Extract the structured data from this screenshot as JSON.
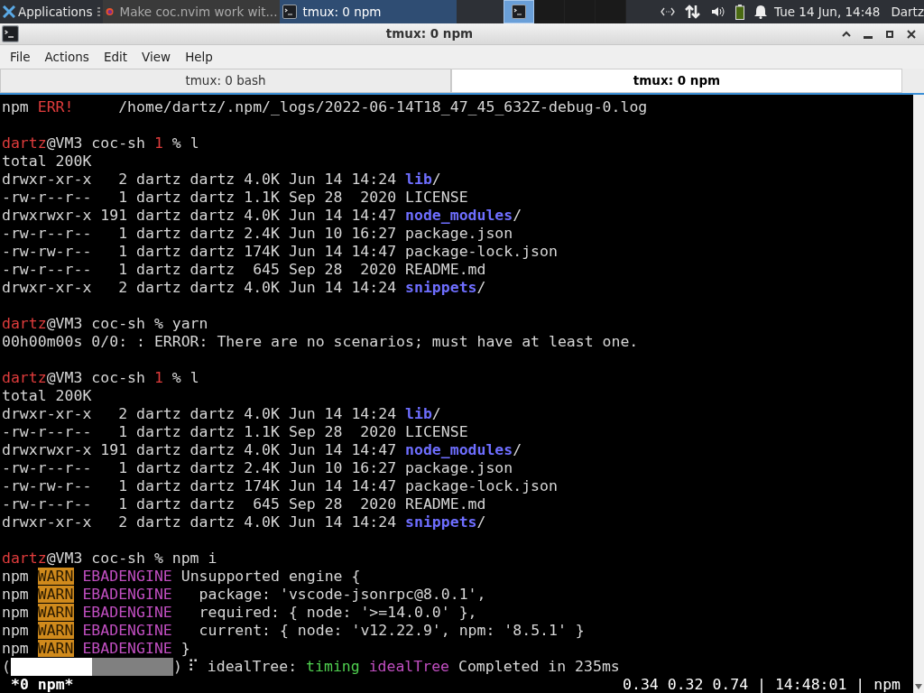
{
  "panel": {
    "apps_label": "Applications",
    "tasks": [
      {
        "title": "Make coc.nvim work wit...",
        "kind": "browser",
        "selected": false
      },
      {
        "title": "tmux: 0 npm",
        "kind": "terminal",
        "selected": true
      }
    ],
    "workspaces": [
      {
        "selected": true
      },
      {
        "selected": false
      },
      {
        "selected": false
      },
      {
        "selected": false
      }
    ],
    "clock": "Tue 14 Jun, 14:48",
    "user": "Dartz"
  },
  "window": {
    "title": "tmux: 0 npm"
  },
  "menu": [
    "File",
    "Actions",
    "Edit",
    "View",
    "Help"
  ],
  "tabs": [
    {
      "label": "tmux: 0 bash",
      "selected": false
    },
    {
      "label": "tmux: 0 npm",
      "selected": true
    }
  ],
  "terminal": {
    "lines": [
      {
        "segments": [
          {
            "text": "npm ",
            "kind": "plain"
          },
          {
            "text": "ERR!",
            "kind": "error"
          },
          {
            "text": "     /home/dartz/.npm/_logs/2022-06-14T18_47_45_632Z-debug-0.log",
            "kind": "plain"
          }
        ]
      },
      {
        "kind": "blank"
      },
      {
        "segments": [
          {
            "text": "dartz",
            "kind": "user"
          },
          {
            "text": "@VM3 coc-sh ",
            "kind": "plain"
          },
          {
            "text": "1",
            "kind": "error"
          },
          {
            "text": " % l",
            "kind": "plain"
          }
        ]
      },
      {
        "segments": [
          {
            "text": "total 200K",
            "kind": "plain"
          }
        ]
      },
      {
        "segments": [
          {
            "text": "drwxr-xr-x   2 dartz dartz 4.0K Jun 14 14:24 ",
            "kind": "plain"
          },
          {
            "text": "lib",
            "kind": "dir"
          },
          {
            "text": "/",
            "kind": "plain"
          }
        ]
      },
      {
        "segments": [
          {
            "text": "-rw-r--r--   1 dartz dartz 1.1K Sep 28  2020 LICENSE",
            "kind": "plain"
          }
        ]
      },
      {
        "segments": [
          {
            "text": "drwxrwxr-x 191 dartz dartz 4.0K Jun 14 14:47 ",
            "kind": "plain"
          },
          {
            "text": "node_modules",
            "kind": "dir"
          },
          {
            "text": "/",
            "kind": "plain"
          }
        ]
      },
      {
        "segments": [
          {
            "text": "-rw-r--r--   1 dartz dartz 2.4K Jun 10 16:27 package.json",
            "kind": "plain"
          }
        ]
      },
      {
        "segments": [
          {
            "text": "-rw-rw-r--   1 dartz dartz 174K Jun 14 14:47 package-lock.json",
            "kind": "plain"
          }
        ]
      },
      {
        "segments": [
          {
            "text": "-rw-r--r--   1 dartz dartz  645 Sep 28  2020 README.md",
            "kind": "plain"
          }
        ]
      },
      {
        "segments": [
          {
            "text": "drwxr-xr-x   2 dartz dartz 4.0K Jun 14 14:24 ",
            "kind": "plain"
          },
          {
            "text": "snippets",
            "kind": "dir"
          },
          {
            "text": "/",
            "kind": "plain"
          }
        ]
      },
      {
        "kind": "blank"
      },
      {
        "segments": [
          {
            "text": "dartz",
            "kind": "user"
          },
          {
            "text": "@VM3 coc-sh % yarn",
            "kind": "plain"
          }
        ]
      },
      {
        "segments": [
          {
            "text": "00h00m00s 0/0: : ERROR: There are no scenarios; must have at least one.",
            "kind": "plain"
          }
        ]
      },
      {
        "kind": "blank"
      },
      {
        "segments": [
          {
            "text": "dartz",
            "kind": "user"
          },
          {
            "text": "@VM3 coc-sh ",
            "kind": "plain"
          },
          {
            "text": "1",
            "kind": "error"
          },
          {
            "text": " % l",
            "kind": "plain"
          }
        ]
      },
      {
        "segments": [
          {
            "text": "total 200K",
            "kind": "plain"
          }
        ]
      },
      {
        "segments": [
          {
            "text": "drwxr-xr-x   2 dartz dartz 4.0K Jun 14 14:24 ",
            "kind": "plain"
          },
          {
            "text": "lib",
            "kind": "dir"
          },
          {
            "text": "/",
            "kind": "plain"
          }
        ]
      },
      {
        "segments": [
          {
            "text": "-rw-r--r--   1 dartz dartz 1.1K Sep 28  2020 LICENSE",
            "kind": "plain"
          }
        ]
      },
      {
        "segments": [
          {
            "text": "drwxrwxr-x 191 dartz dartz 4.0K Jun 14 14:47 ",
            "kind": "plain"
          },
          {
            "text": "node_modules",
            "kind": "dir"
          },
          {
            "text": "/",
            "kind": "plain"
          }
        ]
      },
      {
        "segments": [
          {
            "text": "-rw-r--r--   1 dartz dartz 2.4K Jun 10 16:27 package.json",
            "kind": "plain"
          }
        ]
      },
      {
        "segments": [
          {
            "text": "-rw-rw-r--   1 dartz dartz 174K Jun 14 14:47 package-lock.json",
            "kind": "plain"
          }
        ]
      },
      {
        "segments": [
          {
            "text": "-rw-r--r--   1 dartz dartz  645 Sep 28  2020 README.md",
            "kind": "plain"
          }
        ]
      },
      {
        "segments": [
          {
            "text": "drwxr-xr-x   2 dartz dartz 4.0K Jun 14 14:24 ",
            "kind": "plain"
          },
          {
            "text": "snippets",
            "kind": "dir"
          },
          {
            "text": "/",
            "kind": "plain"
          }
        ]
      },
      {
        "kind": "blank"
      },
      {
        "segments": [
          {
            "text": "dartz",
            "kind": "user"
          },
          {
            "text": "@VM3 coc-sh % npm i",
            "kind": "plain"
          }
        ]
      },
      {
        "segments": [
          {
            "text": "npm ",
            "kind": "plain"
          },
          {
            "text": "WARN",
            "kind": "warn"
          },
          {
            "text": " EBADENGINE",
            "kind": "code"
          },
          {
            "text": " Unsupported engine {",
            "kind": "plain"
          }
        ]
      },
      {
        "segments": [
          {
            "text": "npm ",
            "kind": "plain"
          },
          {
            "text": "WARN",
            "kind": "warn"
          },
          {
            "text": " EBADENGINE",
            "kind": "code"
          },
          {
            "text": "   package: 'vscode-jsonrpc@8.0.1',",
            "kind": "plain"
          }
        ]
      },
      {
        "segments": [
          {
            "text": "npm ",
            "kind": "plain"
          },
          {
            "text": "WARN",
            "kind": "warn"
          },
          {
            "text": " EBADENGINE",
            "kind": "code"
          },
          {
            "text": "   required: { node: '>=14.0.0' },",
            "kind": "plain"
          }
        ]
      },
      {
        "segments": [
          {
            "text": "npm ",
            "kind": "plain"
          },
          {
            "text": "WARN",
            "kind": "warn"
          },
          {
            "text": " EBADENGINE",
            "kind": "code"
          },
          {
            "text": "   current: { node: 'v12.22.9', npm: '8.5.1' }",
            "kind": "plain"
          }
        ]
      },
      {
        "segments": [
          {
            "text": "npm ",
            "kind": "plain"
          },
          {
            "text": "WARN",
            "kind": "warn"
          },
          {
            "text": " EBADENGINE",
            "kind": "code"
          },
          {
            "text": " }",
            "kind": "plain"
          }
        ]
      }
    ],
    "progress": {
      "open": "(",
      "level": 0.5,
      "close": ")",
      "spinner": "⠏",
      "segments": [
        {
          "text": " idealTree: ",
          "kind": "plain"
        },
        {
          "text": "timing",
          "kind": "success"
        },
        {
          "text": " idealTree",
          "kind": "code"
        },
        {
          "text": " Completed in 235ms",
          "kind": "plain"
        }
      ]
    },
    "status_left": "*0 npm*",
    "status_right": "0.34 0.32 0.74 | 14:48:01 | npm"
  }
}
